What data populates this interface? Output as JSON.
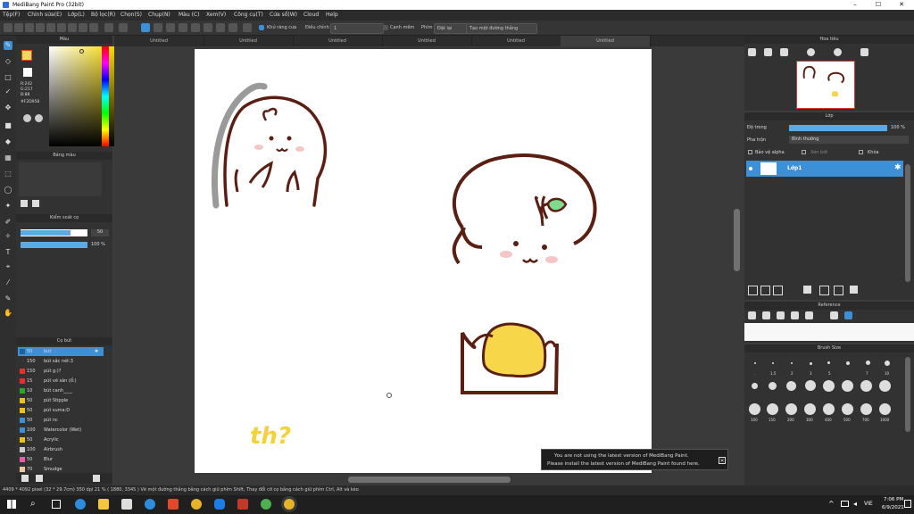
{
  "window": {
    "title": "MediBang Paint Pro (32bit)",
    "minimize": "–",
    "maximize": "☐",
    "close": "✕"
  },
  "menu": [
    "Tệp(F)",
    "Chỉnh sửa(E)",
    "Lớp(L)",
    "Bộ lọc(R)",
    "Chọn(S)",
    "Chụp(N)",
    "Màu (C)",
    "Xem(V)",
    "Công cụ(T)",
    "Cửa sổ(W)",
    "Cloud",
    "Help"
  ],
  "toolbar": {
    "antialias": "Khử răng cưa",
    "correction_label": "Điều chỉnh",
    "correction_value": "1",
    "snap_label": "Cạnh mềm",
    "snap2_label": "Phím",
    "off_label": "Đặt lại",
    "create_line_label": "Tạo một đường thẳng"
  },
  "tabs": [
    "Untitled",
    "Untitled",
    "Untitled",
    "Untitled",
    "Untitled",
    "Untitled"
  ],
  "color_panel": {
    "title": "Màu",
    "r": "R:242",
    "g": "G:217",
    "b": "B:88",
    "hex": "#F2D958"
  },
  "palette_panel": {
    "title": "Bảng màu"
  },
  "brush_control": {
    "title": "Kiểm soát cọ",
    "size_value": "50",
    "opacity_value": "100 %"
  },
  "brush_list": {
    "title": "Cọ bút",
    "items": [
      {
        "size": "50",
        "name": "bút",
        "color": "#3d8fd6"
      },
      {
        "size": "150",
        "name": "bút sắc nét:3",
        "color": "#333333"
      },
      {
        "size": "150",
        "name": "pút g:)?",
        "color": "#e03131"
      },
      {
        "size": "15",
        "name": "pút vẽ sàn (ổ:)",
        "color": "#e03131"
      },
      {
        "size": "10",
        "name": "bút canh____",
        "color": "#2fa32f"
      },
      {
        "size": "50",
        "name": "pút Stipple",
        "color": "#e8c02a"
      },
      {
        "size": "50",
        "name": "pút suma:D",
        "color": "#e8c02a"
      },
      {
        "size": "50",
        "name": "pút nc",
        "color": "#3d8fd6"
      },
      {
        "size": "100",
        "name": "Watercolor (Wet)",
        "color": "#3d8fd6"
      },
      {
        "size": "50",
        "name": "Acrylic",
        "color": "#e8c02a"
      },
      {
        "size": "100",
        "name": "Airbrush",
        "color": "#cccccc"
      },
      {
        "size": "50",
        "name": "Blur",
        "color": "#e45ea8"
      },
      {
        "size": "70",
        "name": "Smudge",
        "color": "#f0c8a0"
      }
    ]
  },
  "navigator": {
    "title": "Hoa tiêu"
  },
  "layers": {
    "title": "Lớp",
    "opacity_label": "Độ trong",
    "opacity_value": "100 %",
    "blend_label": "Pha trộn",
    "blend_value": "Bình thường",
    "protect_alpha": "Bảo vệ alpha",
    "clipping": "Xén bớt",
    "lock": "Khóa",
    "layer_name": "Lớp1"
  },
  "reference": {
    "title": "Reference"
  },
  "brush_size": {
    "title": "Brush Size",
    "small_labels": [
      ".",
      "1.5",
      "2",
      "3",
      "5",
      "7",
      "10"
    ],
    "large_labels": [
      "100",
      "150",
      "200",
      "300",
      "400",
      "500",
      "700",
      "1000"
    ]
  },
  "notice": {
    "line1": "You are not using the latest version of MediBang Paint.",
    "line2": "Please install the latest version of MediBang Paint found here."
  },
  "status": {
    "text": "4409 * 4092 pixel  (32 * 29.7cm)  350 dpi  21 %  ( 1880, 3345 )  Vẽ một đường thẳng bằng cách giữ phím Shift, Thay đổi cỡ cọ bằng cách giữ phím Ctrl, Alt và kéo"
  },
  "canvas_text": "th?",
  "taskbar": {
    "language": "VIE",
    "time": "7:06 PM",
    "date": "6/9/2021"
  },
  "colors": {
    "accent": "#3d8fd6",
    "ink": "#5a1e12",
    "leaf": "#7fd98e",
    "yellow": "#f7d64a",
    "handwriting": "#f3d23a"
  }
}
